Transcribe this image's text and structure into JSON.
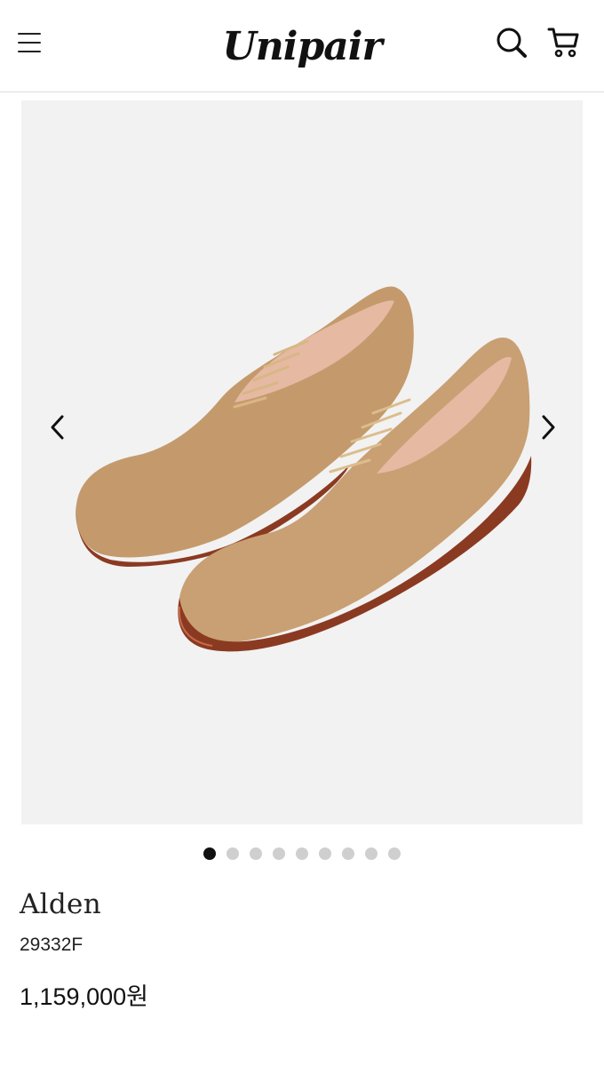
{
  "header": {
    "logo_text": "Unipair",
    "icons": {
      "menu": "hamburger-menu-icon",
      "search": "search-icon",
      "cart": "cart-icon"
    }
  },
  "gallery": {
    "image_subject": "tan suede plain-toe derby shoes",
    "prev_icon": "chevron-left-icon",
    "next_icon": "chevron-right-icon",
    "total_slides": 9,
    "active_slide": 1
  },
  "product": {
    "brand": "Alden",
    "model": "29332F",
    "price": "1,159,000원"
  },
  "colors": {
    "background": "#ffffff",
    "gallery_bg": "#f2f2f2",
    "dot_active": "#111111",
    "dot_inactive": "#cfcfcf",
    "suede": "#c9a073",
    "sole": "#8b3a22"
  }
}
